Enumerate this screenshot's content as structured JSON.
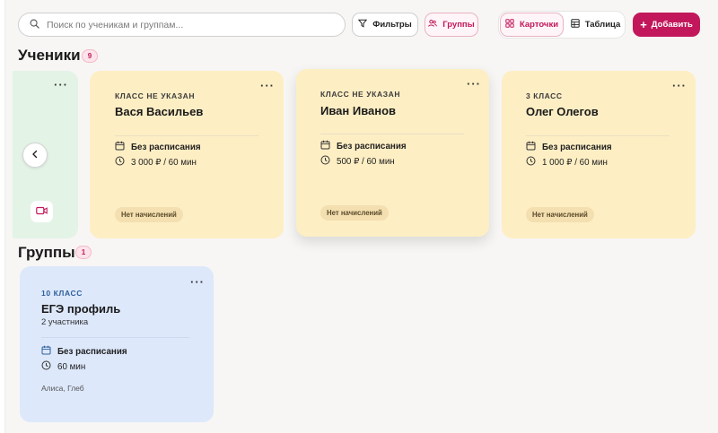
{
  "search": {
    "placeholder": "Поиск по ученикам и группам..."
  },
  "toolbar": {
    "filters_label": "Фильтры",
    "groups_label": "Группы",
    "cards_label": "Карточки",
    "table_label": "Таблица",
    "add_label": "Добавить"
  },
  "colors": {
    "accent": "#c2185b",
    "card_yellow": "#fdeec4",
    "card_green": "#e3f3e6",
    "card_blue": "#dde8fb"
  },
  "students": {
    "title": "Ученики",
    "count": "9",
    "cards": [
      {
        "grade": "КЛАСС НЕ УКАЗАН",
        "name": "Вася Васильев",
        "schedule": "Без расписания",
        "price": "3 000 ₽ / 60 мин",
        "status": "Нет начислений"
      },
      {
        "grade": "КЛАСС НЕ УКАЗАН",
        "name": "Иван Иванов",
        "schedule": "Без расписания",
        "price": "500 ₽ / 60 мин",
        "status": "Нет начислений"
      },
      {
        "grade": "3 КЛАСС",
        "name": "Олег Олегов",
        "schedule": "Без расписания",
        "price": "1 000 ₽ / 60 мин",
        "status": "Нет начислений"
      }
    ]
  },
  "groups": {
    "title": "Группы",
    "count": "1",
    "cards": [
      {
        "grade": "10 КЛАСС",
        "name": "ЕГЭ профиль",
        "participants": "2 участника",
        "schedule": "Без расписания",
        "duration": "60 мин",
        "members": "Алиса, Глеб"
      }
    ]
  },
  "icons": [
    "search-icon",
    "filter-icon",
    "groups-icon",
    "cards-grid-icon",
    "table-icon",
    "plus-icon",
    "more-icon",
    "calendar-icon",
    "clock-icon",
    "chevron-left-icon",
    "video-icon"
  ]
}
